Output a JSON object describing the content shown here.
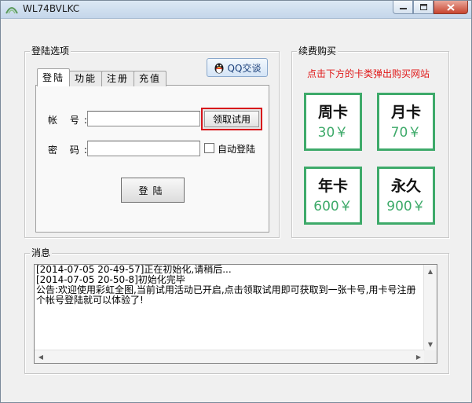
{
  "window": {
    "title": "WL74BVLKC"
  },
  "login_group": {
    "legend": "登陆选项",
    "tabs": [
      {
        "label": "登陆"
      },
      {
        "label": "功能"
      },
      {
        "label": "注册"
      },
      {
        "label": "充值"
      }
    ],
    "active_tab": "登陆",
    "qq_button": "QQ交谈",
    "account_label": "帐 号:",
    "account_value": "",
    "trial_button": "领取试用",
    "password_label": "密 码:",
    "password_value": "",
    "auto_login_label": "自动登陆",
    "auto_login_checked": false,
    "login_button": "登陆"
  },
  "purchase_group": {
    "legend": "续费购买",
    "notice": "点击下方的卡类弹出购买网站",
    "cards": [
      {
        "name": "周卡",
        "price": "30￥"
      },
      {
        "name": "月卡",
        "price": "70￥"
      },
      {
        "name": "年卡",
        "price": "600￥"
      },
      {
        "name": "永久",
        "price": "900￥"
      }
    ],
    "accent_color": "#3eaa6a"
  },
  "message_group": {
    "legend": "消息",
    "lines": [
      "[2014-07-05 20-49-57]正在初始化,请稍后...",
      "[2014-07-05 20-50-8]初始化完毕",
      "公告:欢迎使用彩虹全图,当前试用活动已开启,点击领取试用即可获取到一张卡号,用卡号注册个帐号登陆就可以体验了!"
    ]
  }
}
